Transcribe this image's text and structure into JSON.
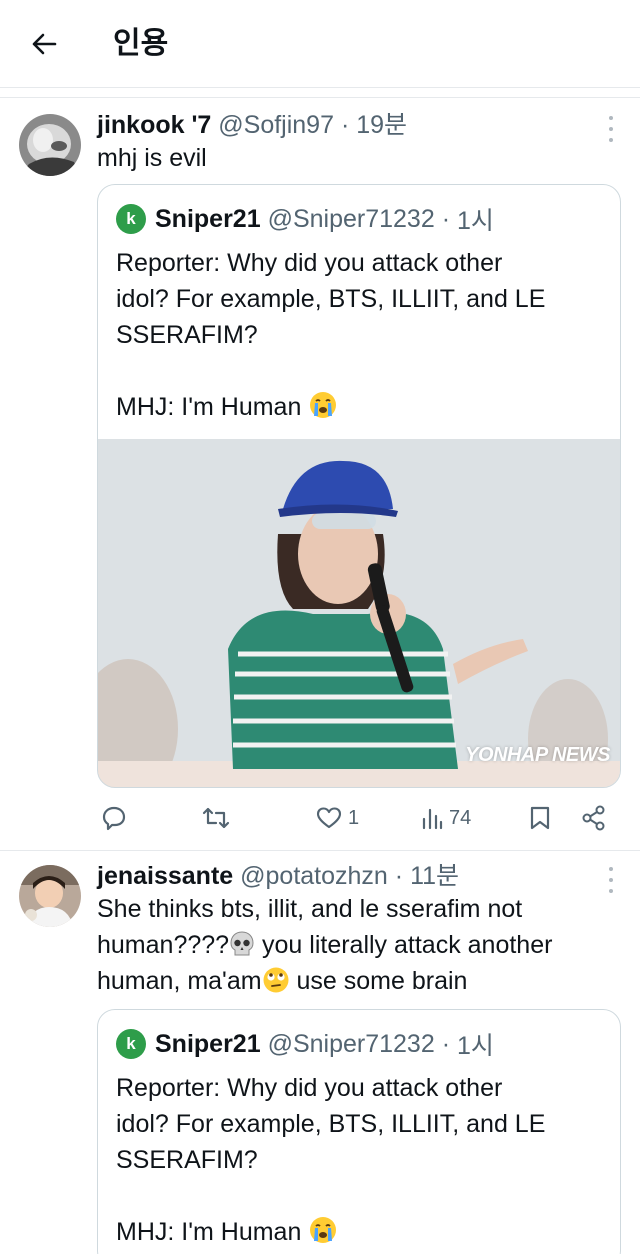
{
  "header": {
    "title": "인용"
  },
  "tweets": [
    {
      "display_name": "jinkook '7",
      "handle": "@Sofjin97",
      "dot": "·",
      "time": "19분",
      "text": "mhj is evil",
      "quote": {
        "avatar_letter": "k",
        "display_name": "Sniper21",
        "handle": "@Sniper71232",
        "dot": "·",
        "time": "1시",
        "text_lines": [
          "Reporter: Why did you attack other",
          "idol? For example, BTS, ILLIIT, and LE",
          "SSERAFIM?"
        ],
        "text_last": "MHJ: I'm Human",
        "media_watermark": "YONHAP NEWS"
      },
      "actions": {
        "reply_count": "",
        "retweet_count": "",
        "like_count": "1",
        "views_count": "74"
      }
    },
    {
      "display_name": "jenaissante",
      "handle": "@potatozhzn",
      "dot": "·",
      "time": "11분",
      "text_line1": "She thinks bts, illit, and le sserafim not",
      "text_line2a": "human????",
      "text_line2b": " you literally attack another",
      "text_line3a": "human, ma'am",
      "text_line3b": " use some brain",
      "quote": {
        "avatar_letter": "k",
        "display_name": "Sniper21",
        "handle": "@Sniper71232",
        "dot": "·",
        "time": "1시",
        "text_lines": [
          "Reporter: Why did you attack other",
          "idol? For example, BTS, ILLIIT, and LE",
          "SSERAFIM?"
        ],
        "text_last": "MHJ: I'm Human"
      }
    }
  ],
  "colors": {
    "text": "#0f1419",
    "secondary": "#536471",
    "border": "#cfd9de",
    "accent_avatar": "#2e9d4a"
  },
  "icons": [
    "back-arrow-icon",
    "more-icon",
    "reply-icon",
    "retweet-icon",
    "like-icon",
    "views-icon",
    "bookmark-icon",
    "share-icon",
    "crying-face-icon",
    "skull-icon",
    "eye-roll-face-icon"
  ]
}
